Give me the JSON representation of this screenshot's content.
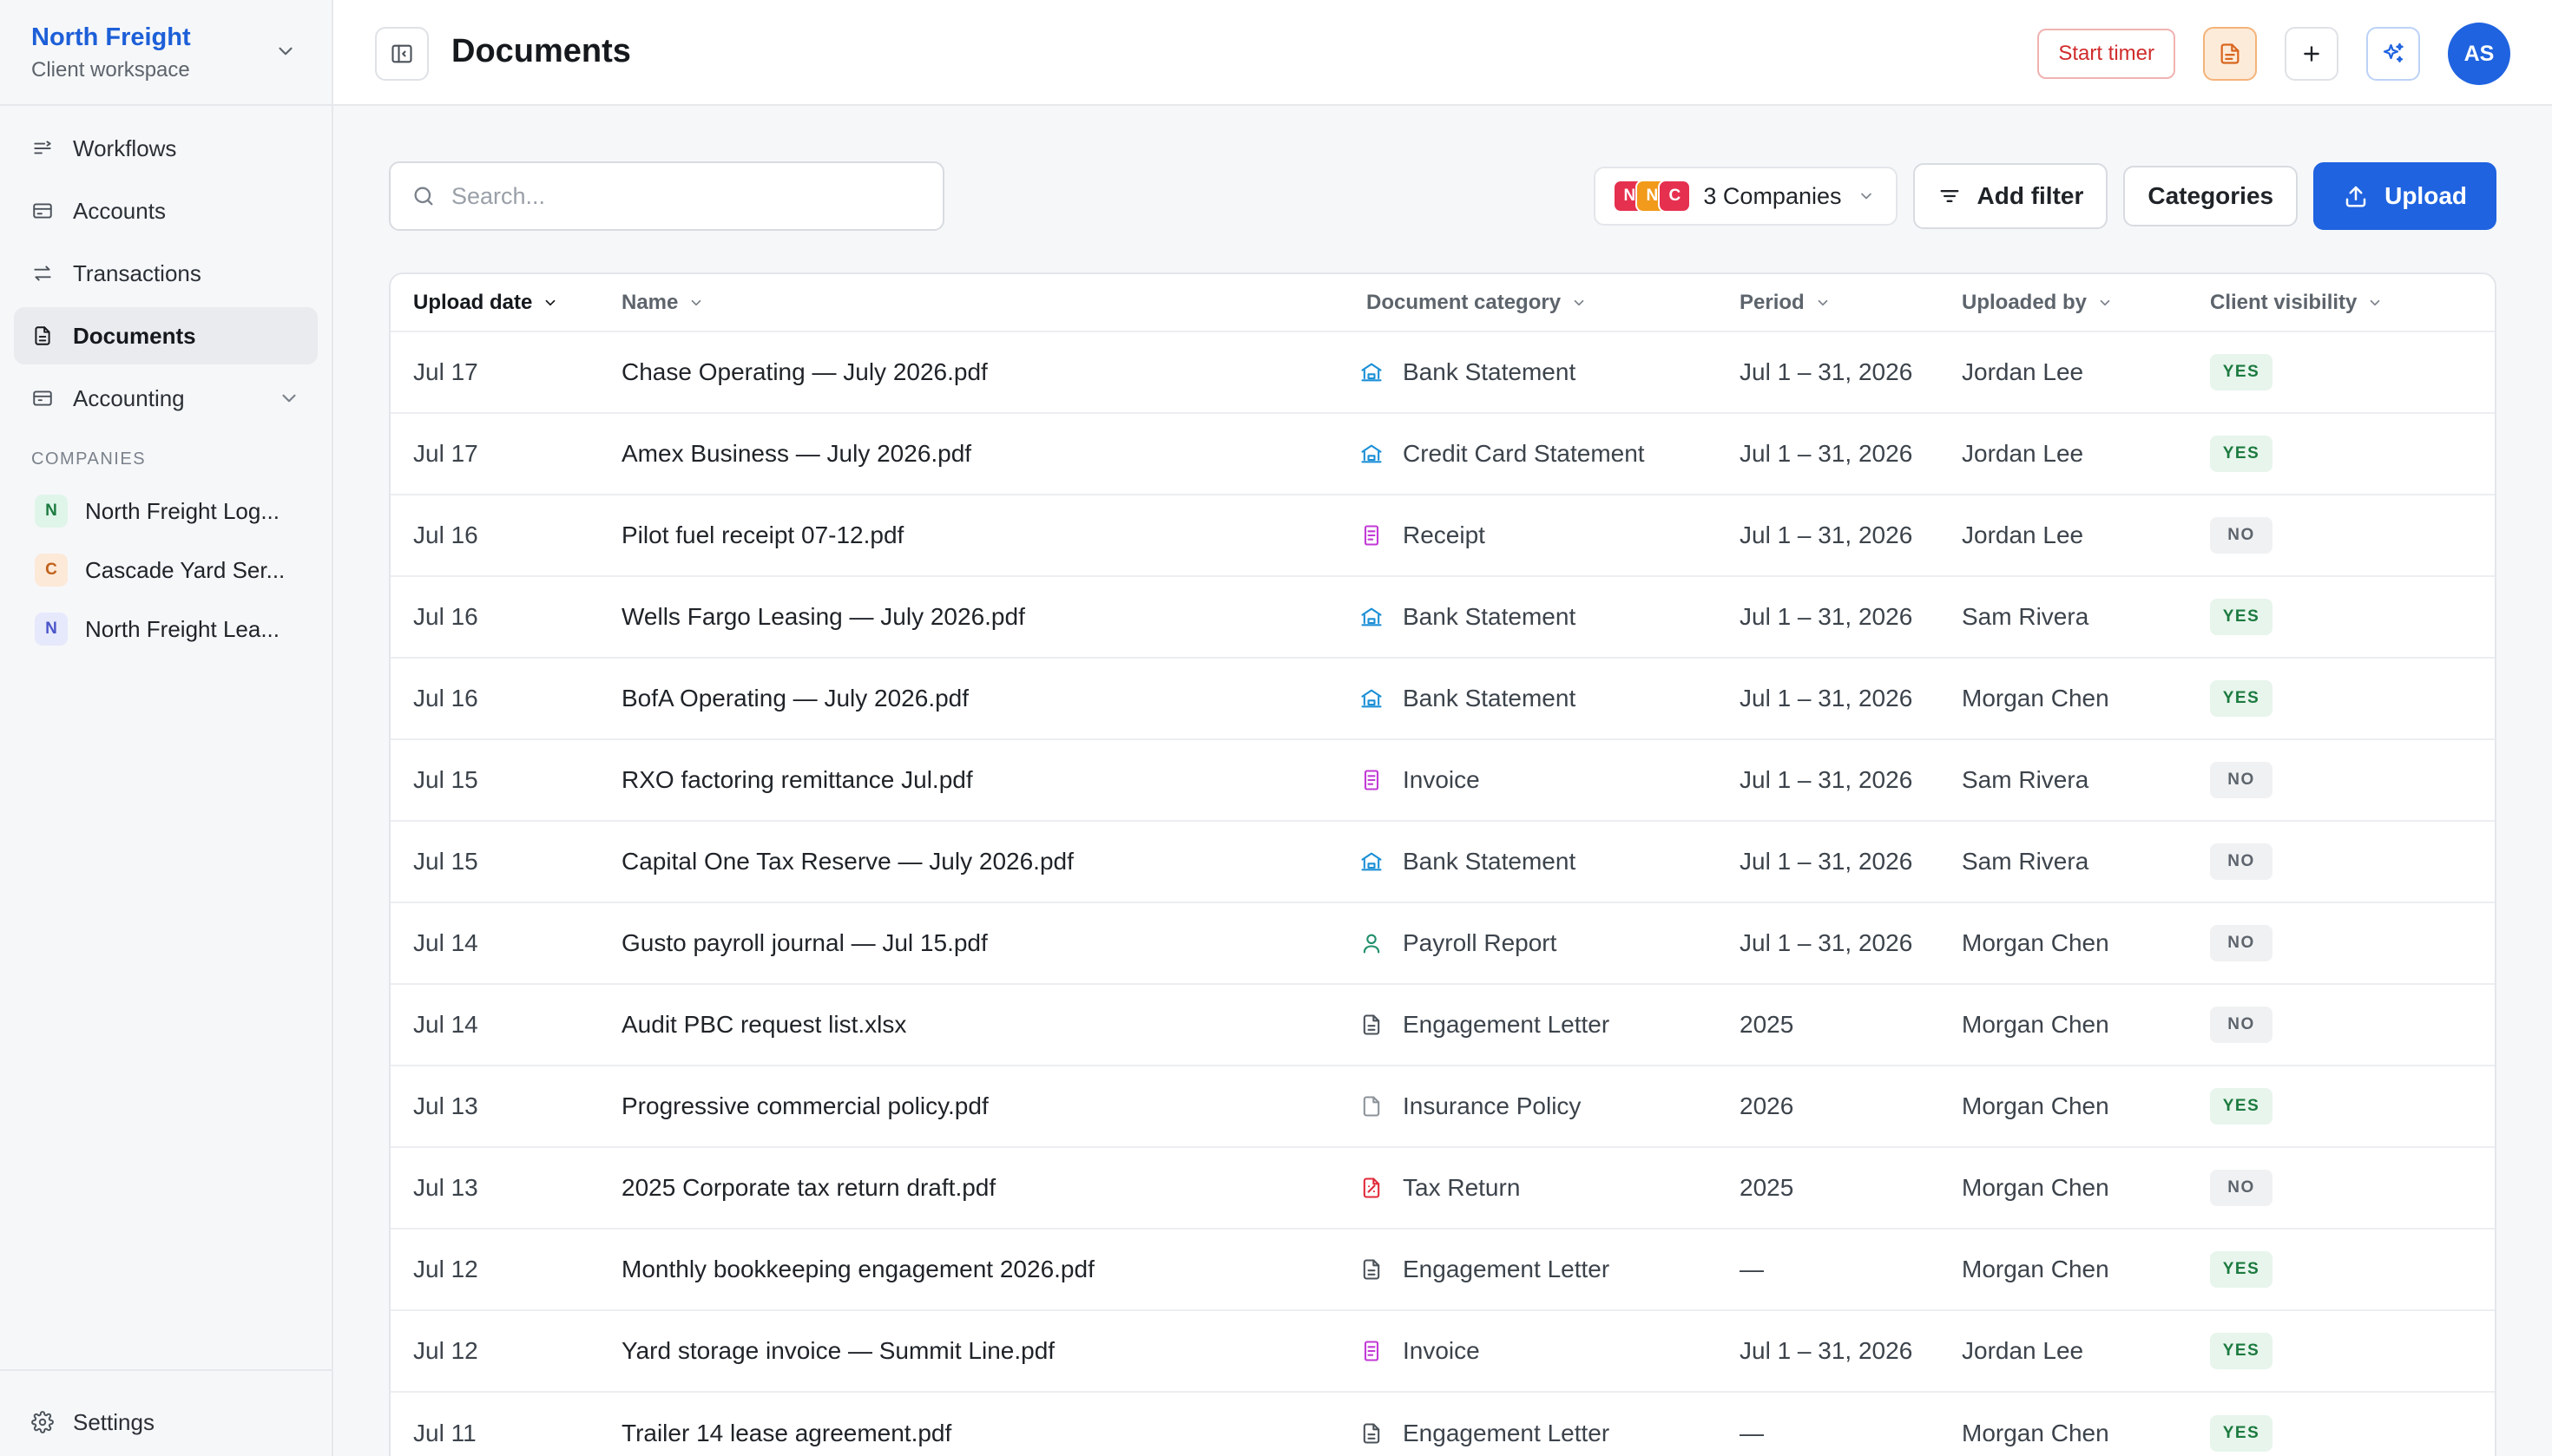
{
  "workspace": {
    "name": "North Freight",
    "subtitle": "Client workspace"
  },
  "nav": [
    {
      "label": "Workflows",
      "icon": "workflow-icon"
    },
    {
      "label": "Accounts",
      "icon": "card-icon"
    },
    {
      "label": "Transactions",
      "icon": "swap-arrows-icon"
    },
    {
      "label": "Documents",
      "icon": "document-icon",
      "active": true
    },
    {
      "label": "Accounting",
      "icon": "ledger-icon",
      "expandable": true
    }
  ],
  "companies_section": {
    "label": "COMPANIES",
    "items": [
      {
        "initial": "N",
        "name": "North Freight Logistics",
        "display": "North Freight Log...",
        "bg": "#dff5ea",
        "fg": "#1c7a3f"
      },
      {
        "initial": "C",
        "name": "Cascade Yard Services",
        "display": "Cascade Yard Ser...",
        "bg": "#fde9d8",
        "fg": "#c0611a"
      },
      {
        "initial": "N",
        "name": "North Freight Leasing",
        "display": "North Freight Lea...",
        "bg": "#e6e8fb",
        "fg": "#4a55c9"
      }
    ]
  },
  "settings_label": "Settings",
  "page_title": "Documents",
  "top_actions": {
    "timer_label": "Start timer",
    "avatar_initials": "AS",
    "icons": [
      "notes-icon",
      "plus-icon",
      "sparkle-icon"
    ]
  },
  "search": {
    "placeholder": "Search...",
    "value": ""
  },
  "company_filter": {
    "label": "3 Companies",
    "dots": [
      {
        "initial": "N",
        "color": "#e6304f"
      },
      {
        "initial": "N",
        "color": "#f19a1b"
      },
      {
        "initial": "C",
        "color": "#e6304f"
      }
    ]
  },
  "buttons": {
    "add_filter": "Add filter",
    "categories": "Categories",
    "upload": "Upload"
  },
  "columns": [
    "Upload date",
    "Name",
    "Document category",
    "Period",
    "Uploaded by",
    "Client visibility"
  ],
  "category_icons": {
    "Bank Statement": {
      "icon": "bank-icon",
      "color": "#1b8fd6"
    },
    "Credit Card Statement": {
      "icon": "bank-icon",
      "color": "#1b8fd6"
    },
    "Receipt": {
      "icon": "receipt-icon",
      "color": "#c23ad6"
    },
    "Invoice": {
      "icon": "receipt-icon",
      "color": "#c23ad6"
    },
    "Payroll Report": {
      "icon": "person-icon",
      "color": "#1f8f6a"
    },
    "Engagement Letter": {
      "icon": "file-text-icon",
      "color": "#4b525a"
    },
    "Insurance Policy": {
      "icon": "file-icon",
      "color": "#8d939a"
    },
    "Tax Return": {
      "icon": "tax-file-icon",
      "color": "#e02b3a"
    }
  },
  "rows": [
    {
      "date": "Jul 17",
      "name": "Chase Operating — July 2026.pdf",
      "category": "Bank Statement",
      "period": "Jul 1 – 31, 2026",
      "uploaded_by": "Jordan Lee",
      "visibility": "YES"
    },
    {
      "date": "Jul 17",
      "name": "Amex Business — July 2026.pdf",
      "category": "Credit Card Statement",
      "period": "Jul 1 – 31, 2026",
      "uploaded_by": "Jordan Lee",
      "visibility": "YES"
    },
    {
      "date": "Jul 16",
      "name": "Pilot fuel receipt 07-12.pdf",
      "category": "Receipt",
      "period": "Jul 1 – 31, 2026",
      "uploaded_by": "Jordan Lee",
      "visibility": "NO"
    },
    {
      "date": "Jul 16",
      "name": "Wells Fargo Leasing — July 2026.pdf",
      "category": "Bank Statement",
      "period": "Jul 1 – 31, 2026",
      "uploaded_by": "Sam Rivera",
      "visibility": "YES"
    },
    {
      "date": "Jul 16",
      "name": "BofA Operating — July 2026.pdf",
      "category": "Bank Statement",
      "period": "Jul 1 – 31, 2026",
      "uploaded_by": "Morgan Chen",
      "visibility": "YES"
    },
    {
      "date": "Jul 15",
      "name": "RXO factoring remittance Jul.pdf",
      "category": "Invoice",
      "period": "Jul 1 – 31, 2026",
      "uploaded_by": "Sam Rivera",
      "visibility": "NO"
    },
    {
      "date": "Jul 15",
      "name": "Capital One Tax Reserve — July 2026.pdf",
      "category": "Bank Statement",
      "period": "Jul 1 – 31, 2026",
      "uploaded_by": "Sam Rivera",
      "visibility": "NO"
    },
    {
      "date": "Jul 14",
      "name": "Gusto payroll journal — Jul 15.pdf",
      "category": "Payroll Report",
      "period": "Jul 1 – 31, 2026",
      "uploaded_by": "Morgan Chen",
      "visibility": "NO"
    },
    {
      "date": "Jul 14",
      "name": "Audit PBC request list.xlsx",
      "category": "Engagement Letter",
      "period": "2025",
      "uploaded_by": "Morgan Chen",
      "visibility": "NO"
    },
    {
      "date": "Jul 13",
      "name": "Progressive commercial policy.pdf",
      "category": "Insurance Policy",
      "period": "2026",
      "uploaded_by": "Morgan Chen",
      "visibility": "YES"
    },
    {
      "date": "Jul 13",
      "name": "2025 Corporate tax return draft.pdf",
      "category": "Tax Return",
      "period": "2025",
      "uploaded_by": "Morgan Chen",
      "visibility": "NO"
    },
    {
      "date": "Jul 12",
      "name": "Monthly bookkeeping engagement 2026.pdf",
      "category": "Engagement Letter",
      "period": "—",
      "uploaded_by": "Morgan Chen",
      "visibility": "YES"
    },
    {
      "date": "Jul 12",
      "name": "Yard storage invoice — Summit Line.pdf",
      "category": "Invoice",
      "period": "Jul 1 – 31, 2026",
      "uploaded_by": "Jordan Lee",
      "visibility": "YES"
    },
    {
      "date": "Jul 11",
      "name": "Trailer 14 lease agreement.pdf",
      "category": "Engagement Letter",
      "period": "—",
      "uploaded_by": "Morgan Chen",
      "visibility": "YES"
    }
  ]
}
